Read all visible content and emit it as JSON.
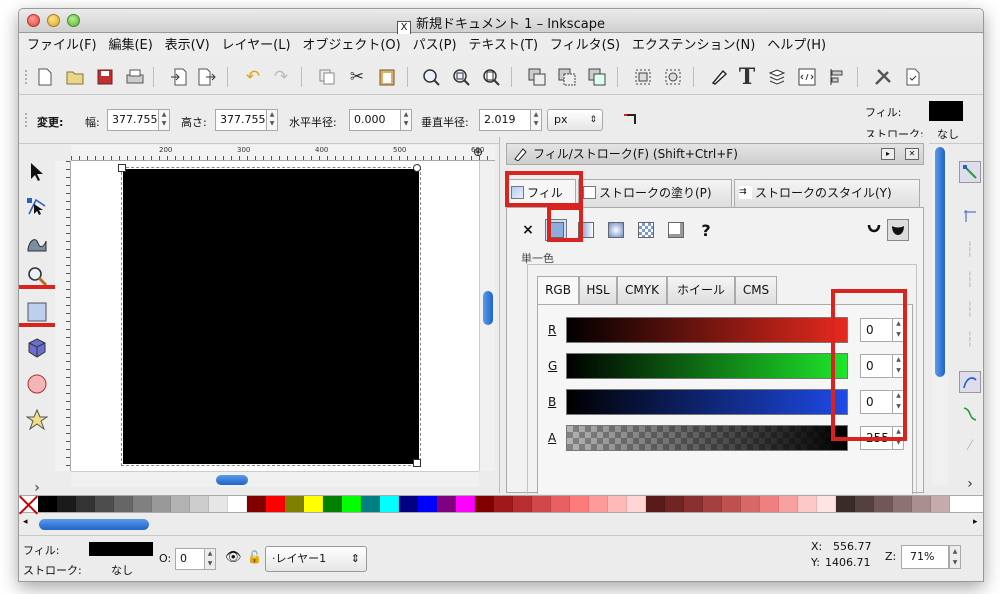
{
  "window": {
    "title": "新規ドキュメント 1 – Inkscape",
    "title_icon": "X"
  },
  "menu": [
    "ファイル(F)",
    "編集(E)",
    "表示(V)",
    "レイヤー(L)",
    "オブジェクト(O)",
    "パス(P)",
    "テキスト(T)",
    "フィルタ(S)",
    "エクステンション(N)",
    "ヘルプ(H)"
  ],
  "toolbar": {
    "icons": [
      "new-document-icon",
      "open-icon",
      "save-icon",
      "print-icon",
      "import-icon",
      "export-icon",
      "undo-icon",
      "redo-icon",
      "copy-icon",
      "cut-icon",
      "paste-icon",
      "zoom-selection-icon",
      "zoom-drawing-icon",
      "zoom-page-icon",
      "duplicate-icon",
      "clone-icon",
      "unlink-clone-icon",
      "group-icon",
      "ungroup-icon",
      "fill-stroke-icon",
      "text-tool-icon",
      "layers-icon",
      "xml-editor-icon",
      "align-icon",
      "preferences-icon",
      "document-properties-icon"
    ],
    "text_tool_glyph": "T"
  },
  "controls": {
    "change_label": "変更:",
    "width_label": "幅:",
    "width_value": "377.755",
    "height_label": "高さ:",
    "height_value": "377.755",
    "rx_label": "水平半径:",
    "rx_value": "0.000",
    "ry_label": "垂直半径:",
    "ry_value": "2.019",
    "unit": "px",
    "fill_label": "フィル:",
    "stroke_label": "ストローク:",
    "stroke_value": "なし",
    "fill_color": "#000000"
  },
  "ruler": {
    "ticks": [
      "200",
      "300",
      "400",
      "500",
      "600"
    ]
  },
  "dock": {
    "title": "フィル/ストローク(F) (Shift+Ctrl+F)",
    "tabs": [
      "フィル",
      "ストロークの塗り(P)",
      "ストロークのスタイル(Y)"
    ],
    "paint_none": "×",
    "paint_unset": "?",
    "section_label": "単一色",
    "color_tabs": [
      "RGB",
      "HSL",
      "CMYK",
      "ホイール",
      "CMS"
    ],
    "channels": [
      {
        "label": "R",
        "value": "0"
      },
      {
        "label": "G",
        "value": "0"
      },
      {
        "label": "B",
        "value": "0"
      },
      {
        "label": "A",
        "value": "255"
      }
    ]
  },
  "palette": [
    "#000000",
    "#1a1a1a",
    "#333333",
    "#4d4d4d",
    "#666666",
    "#808080",
    "#999999",
    "#b3b3b3",
    "#cccccc",
    "#e6e6e6",
    "#ffffff",
    "#800000",
    "#ff0000",
    "#808000",
    "#ffff00",
    "#008000",
    "#00ff00",
    "#008080",
    "#00ffff",
    "#000080",
    "#0000ff",
    "#800080",
    "#ff00ff",
    "#800000",
    "#a01818",
    "#b82e2e",
    "#d04848",
    "#e86060",
    "#ff7b7b",
    "#ff9a9a",
    "#ffb9b9",
    "#ffd5d5",
    "#5a1a1a",
    "#702424",
    "#8a3030",
    "#a44040",
    "#be5050",
    "#d86868",
    "#f08080",
    "#f8a0a0",
    "#fcc8c8",
    "#ffe4e4",
    "#3a2a2a",
    "#554040",
    "#705858",
    "#8c7272",
    "#a88e8e",
    "#c4acac"
  ],
  "status": {
    "fill_label": "フィル:",
    "stroke_label": "ストローク:",
    "stroke_value": "なし",
    "opacity_label": "O:",
    "opacity_value": "0",
    "layer": "·レイヤー1",
    "x_label": "X:",
    "x_value": "556.77",
    "y_label": "Y:",
    "y_value": "1406.71",
    "zoom_label": "Z:",
    "zoom_value": "71%"
  },
  "colors": {
    "highlight": "#d9231f",
    "scroll_accent": "#2f76d6"
  }
}
